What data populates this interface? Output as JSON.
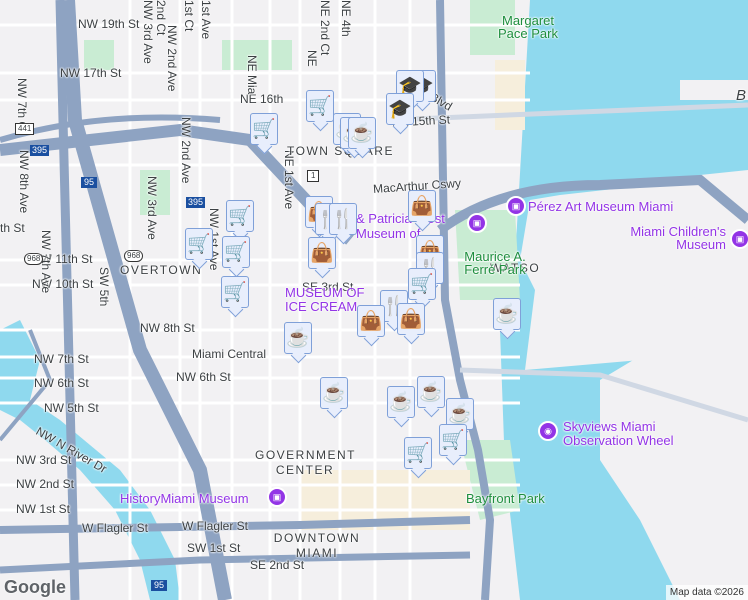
{
  "streets": {
    "nw19": "NW 19th St",
    "nw17": "NW 17th St",
    "nw11": "NW 11th St",
    "nw10": "NW 10th St",
    "nw8": "NW 8th St",
    "nw7": "NW 7th St",
    "nw6": "NW 6th St",
    "nw5": "NW 5th St",
    "nw3": "NW 3rd St",
    "nw2": "NW 2nd St",
    "nw1": "NW 1st St",
    "wflagler": "W Flagler St",
    "sw1": "SW 1st St",
    "se2": "SE 2nd St",
    "se3": "SE 3rd St",
    "ne15": "NE 15th St",
    "ne16": "NE 16th",
    "macarthur": "MacArthur Cswy",
    "portblvd": "Port Blvd",
    "nriver": "NW N River Dr",
    "nw7ave": "NW 7th Ave",
    "nw7ct": "NW 7th Ct",
    "nw3ave": "NW 3rd Ave",
    "nw3ave_b": "NW 3rd Ave",
    "nw2ct": "2nd Ct",
    "nw2ave": "NW 2nd Ave",
    "nw2ave_b": "NW 2nd Ave",
    "nw1ct": "1st Ct",
    "nw1ave": "1st Ave",
    "nw1ave_b": "NW 1st Ave",
    "nemiami": "NE Mia",
    "ne2ct": "NE 2nd Ct",
    "ne4": "NE 4th",
    "ne1ave": "NE 1st Ave",
    "nw8ave": "NW 8th Ave",
    "sw5": "SW 5th",
    "nw7st_left": "th St",
    "ne": "NE"
  },
  "shields": {
    "i395a": "395",
    "i395b": "395",
    "i95a": "95",
    "i95b": "95",
    "us441": "441",
    "us1": "1",
    "sr968a": "968",
    "sr968b": "968"
  },
  "neighborhoods": {
    "town_square": "TOWN SQUARE",
    "overtown": "OVERTOWN",
    "gov_center": "GOVERNMENT CENTER",
    "downtown": "DOWNTOWN MIAMI",
    "watson": "WATSO",
    "b": "B"
  },
  "pois": {
    "perez": "Pérez Art Museum Miami",
    "childrens": "Miami Children's Museum",
    "frost": "& Patricia Frost Museum of Science",
    "ice_cream": "MUSEUM OF ICE CREAM",
    "history": "HistoryMiami Museum",
    "skyviews": "Skyviews Miami Observation Wheel",
    "central": "Miami Central"
  },
  "parks": {
    "margaret": "Margaret Pace Park",
    "ferre": "Maurice A. Ferré Park",
    "bayfront": "Bayfront Park"
  },
  "attribution": {
    "google": "Google",
    "credit": "Map data ©2026"
  },
  "colors": {
    "water": "#8fd9ee",
    "highway": "#8ea3c2",
    "park": "#c9ecd3",
    "marker": "#0b3d63"
  }
}
